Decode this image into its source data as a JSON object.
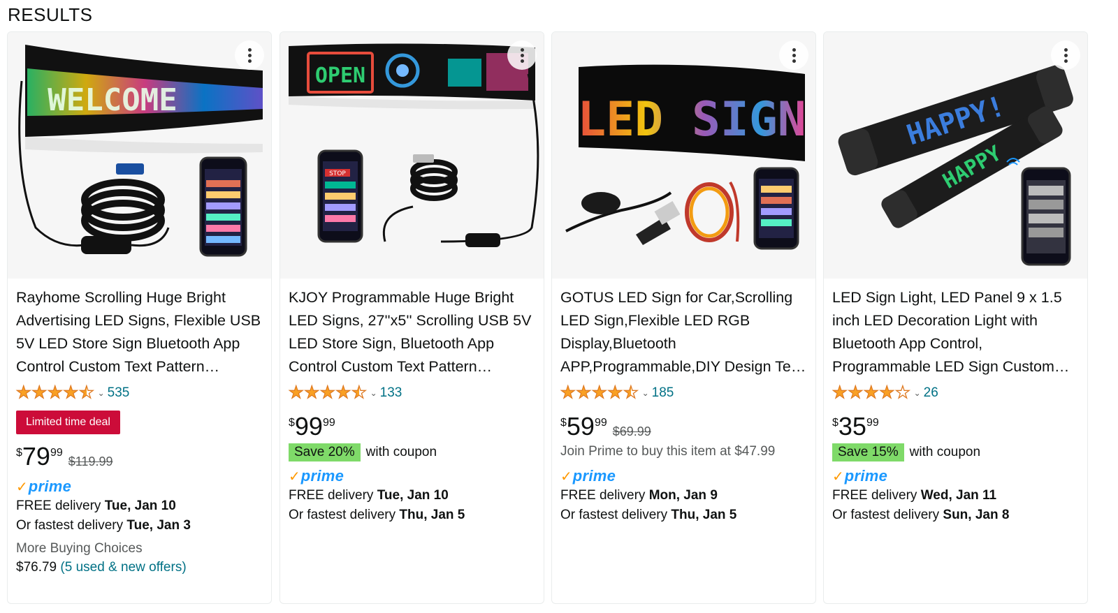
{
  "header": {
    "title": "RESULTS"
  },
  "colors": {
    "deal": "#cc0c39",
    "coupon": "#7fda69",
    "link": "#007185",
    "star": "#f9a024",
    "prime": "#1a98ff"
  },
  "products": [
    {
      "title": "Rayhome Scrolling Huge Bright Advertising LED Signs, Flexible USB 5V LED Store Sign Bluetooth App Control Custom Text Pattern Animation",
      "image_texts": [
        "WELCOME"
      ],
      "rating": 4.5,
      "review_count": "535",
      "badge": "Limited time deal",
      "price": {
        "currency": "$",
        "whole": "79",
        "fraction": "99",
        "list_price": "$119.99"
      },
      "prime": "prime",
      "delivery": {
        "free_label": "FREE delivery",
        "free_date": "Tue, Jan 10",
        "fastest_label": "Or fastest delivery",
        "fastest_date": "Tue, Jan 3"
      },
      "more_buying": {
        "label": "More Buying Choices",
        "price": "$76.79",
        "offers": "(5 used & new offers)"
      }
    },
    {
      "title": "KJOY Programmable Huge Bright LED Signs, 27''x5'' Scrolling USB 5V LED Store Sign, Bluetooth App Control Custom Text Pattern Animation",
      "image_texts": [
        "OPEN",
        "STOP"
      ],
      "rating": 4.5,
      "review_count": "133",
      "price": {
        "currency": "$",
        "whole": "99",
        "fraction": "99"
      },
      "coupon": {
        "save": "Save 20%",
        "text": "with coupon"
      },
      "prime": "prime",
      "delivery": {
        "free_label": "FREE delivery",
        "free_date": "Tue, Jan 10",
        "fastest_label": "Or fastest delivery",
        "fastest_date": "Thu, Jan 5"
      }
    },
    {
      "title": "GOTUS LED Sign for Car,Scrolling LED Sign,Flexible LED RGB Display,Bluetooth APP,Programmable,DIY Design Text Pattern",
      "image_texts": [
        "LED SIGN"
      ],
      "rating": 4.5,
      "review_count": "185",
      "price": {
        "currency": "$",
        "whole": "59",
        "fraction": "99",
        "list_price": "$69.99"
      },
      "join_prime": "Join Prime to buy this item at $47.99",
      "prime": "prime",
      "delivery": {
        "free_label": "FREE delivery",
        "free_date": "Mon, Jan 9",
        "fastest_label": "Or fastest delivery",
        "fastest_date": "Thu, Jan 5"
      }
    },
    {
      "title": "LED Sign Light, LED Panel 9 x 1.5 inch LED Decoration Light with Bluetooth App Control, Programmable LED Sign Custom Text Pattern",
      "image_texts": [
        "HAPPY!",
        "HAPPY"
      ],
      "rating": 4.0,
      "review_count": "26",
      "price": {
        "currency": "$",
        "whole": "35",
        "fraction": "99"
      },
      "coupon": {
        "save": "Save 15%",
        "text": "with coupon"
      },
      "prime": "prime",
      "delivery": {
        "free_label": "FREE delivery",
        "free_date": "Wed, Jan 11",
        "fastest_label": "Or fastest delivery",
        "fastest_date": "Sun, Jan 8"
      }
    }
  ]
}
